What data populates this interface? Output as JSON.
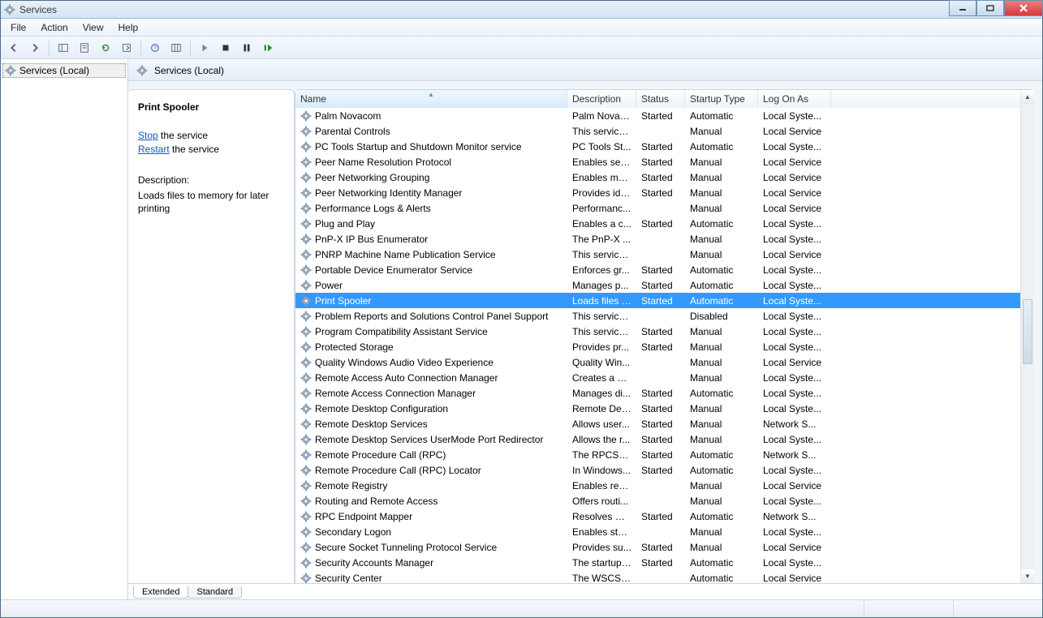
{
  "window": {
    "title": "Services"
  },
  "menu": {
    "file": "File",
    "action": "Action",
    "view": "View",
    "help": "Help"
  },
  "tree": {
    "root": "Services (Local)"
  },
  "pane": {
    "title": "Services (Local)"
  },
  "details": {
    "selected_name": "Print Spooler",
    "stop_link": "Stop",
    "stop_suffix": " the service",
    "restart_link": "Restart",
    "restart_suffix": " the service",
    "desc_label": "Description:",
    "desc_text": "Loads files to memory for later printing"
  },
  "columns": {
    "name": "Name",
    "description": "Description",
    "status": "Status",
    "startup": "Startup Type",
    "logon": "Log On As"
  },
  "tabs": {
    "extended": "Extended",
    "standard": "Standard"
  },
  "services": [
    {
      "name": "Palm Novacom",
      "desc": "Palm Novac...",
      "status": "Started",
      "startup": "Automatic",
      "logon": "Local Syste..."
    },
    {
      "name": "Parental Controls",
      "desc": "This service ...",
      "status": "",
      "startup": "Manual",
      "logon": "Local Service"
    },
    {
      "name": "PC Tools Startup and Shutdown Monitor service",
      "desc": "PC Tools St...",
      "status": "Started",
      "startup": "Automatic",
      "logon": "Local Syste..."
    },
    {
      "name": "Peer Name Resolution Protocol",
      "desc": "Enables serv...",
      "status": "Started",
      "startup": "Manual",
      "logon": "Local Service"
    },
    {
      "name": "Peer Networking Grouping",
      "desc": "Enables mul...",
      "status": "Started",
      "startup": "Manual",
      "logon": "Local Service"
    },
    {
      "name": "Peer Networking Identity Manager",
      "desc": "Provides ide...",
      "status": "Started",
      "startup": "Manual",
      "logon": "Local Service"
    },
    {
      "name": "Performance Logs & Alerts",
      "desc": "Performanc...",
      "status": "",
      "startup": "Manual",
      "logon": "Local Service"
    },
    {
      "name": "Plug and Play",
      "desc": "Enables a c...",
      "status": "Started",
      "startup": "Automatic",
      "logon": "Local Syste..."
    },
    {
      "name": "PnP-X IP Bus Enumerator",
      "desc": "The PnP-X ...",
      "status": "",
      "startup": "Manual",
      "logon": "Local Syste..."
    },
    {
      "name": "PNRP Machine Name Publication Service",
      "desc": "This service ...",
      "status": "",
      "startup": "Manual",
      "logon": "Local Service"
    },
    {
      "name": "Portable Device Enumerator Service",
      "desc": "Enforces gr...",
      "status": "Started",
      "startup": "Automatic",
      "logon": "Local Syste..."
    },
    {
      "name": "Power",
      "desc": "Manages p...",
      "status": "Started",
      "startup": "Automatic",
      "logon": "Local Syste..."
    },
    {
      "name": "Print Spooler",
      "desc": "Loads files t...",
      "status": "Started",
      "startup": "Automatic",
      "logon": "Local Syste...",
      "selected": true
    },
    {
      "name": "Problem Reports and Solutions Control Panel Support",
      "desc": "This service ...",
      "status": "",
      "startup": "Disabled",
      "logon": "Local Syste..."
    },
    {
      "name": "Program Compatibility Assistant Service",
      "desc": "This service ...",
      "status": "Started",
      "startup": "Manual",
      "logon": "Local Syste..."
    },
    {
      "name": "Protected Storage",
      "desc": "Provides pr...",
      "status": "Started",
      "startup": "Manual",
      "logon": "Local Syste..."
    },
    {
      "name": "Quality Windows Audio Video Experience",
      "desc": "Quality Win...",
      "status": "",
      "startup": "Manual",
      "logon": "Local Service"
    },
    {
      "name": "Remote Access Auto Connection Manager",
      "desc": "Creates a co...",
      "status": "",
      "startup": "Manual",
      "logon": "Local Syste..."
    },
    {
      "name": "Remote Access Connection Manager",
      "desc": "Manages di...",
      "status": "Started",
      "startup": "Automatic",
      "logon": "Local Syste..."
    },
    {
      "name": "Remote Desktop Configuration",
      "desc": "Remote Des...",
      "status": "Started",
      "startup": "Manual",
      "logon": "Local Syste..."
    },
    {
      "name": "Remote Desktop Services",
      "desc": "Allows user...",
      "status": "Started",
      "startup": "Manual",
      "logon": "Network S..."
    },
    {
      "name": "Remote Desktop Services UserMode Port Redirector",
      "desc": "Allows the r...",
      "status": "Started",
      "startup": "Manual",
      "logon": "Local Syste..."
    },
    {
      "name": "Remote Procedure Call (RPC)",
      "desc": "The RPCSS ...",
      "status": "Started",
      "startup": "Automatic",
      "logon": "Network S..."
    },
    {
      "name": "Remote Procedure Call (RPC) Locator",
      "desc": "In Windows...",
      "status": "Started",
      "startup": "Automatic",
      "logon": "Local Syste..."
    },
    {
      "name": "Remote Registry",
      "desc": "Enables rem...",
      "status": "",
      "startup": "Manual",
      "logon": "Local Service"
    },
    {
      "name": "Routing and Remote Access",
      "desc": "Offers routi...",
      "status": "",
      "startup": "Manual",
      "logon": "Local Syste..."
    },
    {
      "name": "RPC Endpoint Mapper",
      "desc": "Resolves RP...",
      "status": "Started",
      "startup": "Automatic",
      "logon": "Network S..."
    },
    {
      "name": "Secondary Logon",
      "desc": "Enables star...",
      "status": "",
      "startup": "Manual",
      "logon": "Local Syste..."
    },
    {
      "name": "Secure Socket Tunneling Protocol Service",
      "desc": "Provides su...",
      "status": "Started",
      "startup": "Manual",
      "logon": "Local Service"
    },
    {
      "name": "Security Accounts Manager",
      "desc": "The startup ...",
      "status": "Started",
      "startup": "Automatic",
      "logon": "Local Syste..."
    },
    {
      "name": "Security Center",
      "desc": "The WSCSV...",
      "status": "",
      "startup": "Automatic",
      "logon": "Local Service"
    }
  ]
}
